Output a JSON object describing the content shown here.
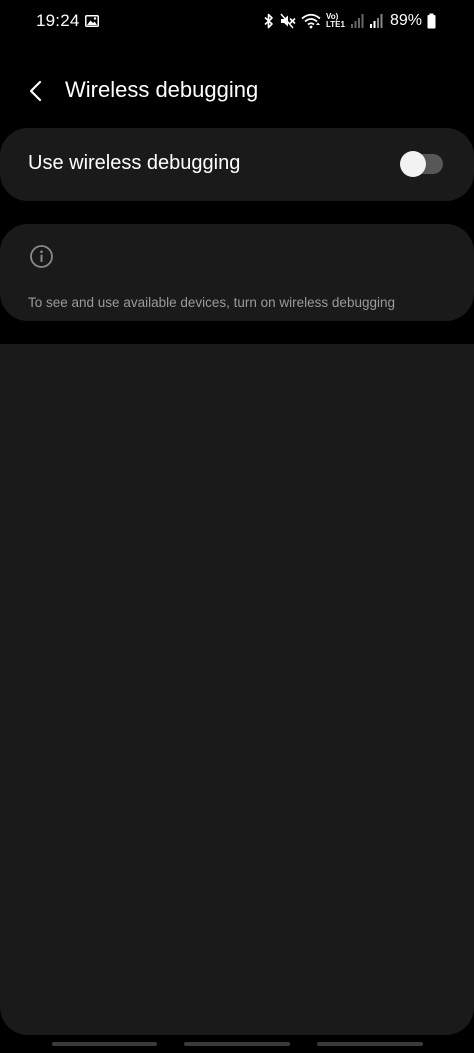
{
  "status_bar": {
    "time": "19:24",
    "volte_line1": "Vo)",
    "volte_line2": "LTE1",
    "battery_percent": "89%",
    "icons": [
      "gallery-icon",
      "bluetooth-icon",
      "mute-icon",
      "wifi-icon",
      "signal-icon",
      "signal-icon-2",
      "battery-icon"
    ]
  },
  "header": {
    "title": "Wireless debugging",
    "back_icon": "chevron-left-icon"
  },
  "toggle_card": {
    "label": "Use wireless debugging",
    "enabled": false
  },
  "info_card": {
    "icon": "info-icon",
    "text": "To see and use available devices, turn on wireless debugging"
  },
  "colors": {
    "background": "#000000",
    "card": "#1a1a1a",
    "text_primary": "#ffffff",
    "text_secondary": "#9a9a9a",
    "switch_track_off": "#575757",
    "switch_thumb": "#f2f2f2"
  }
}
